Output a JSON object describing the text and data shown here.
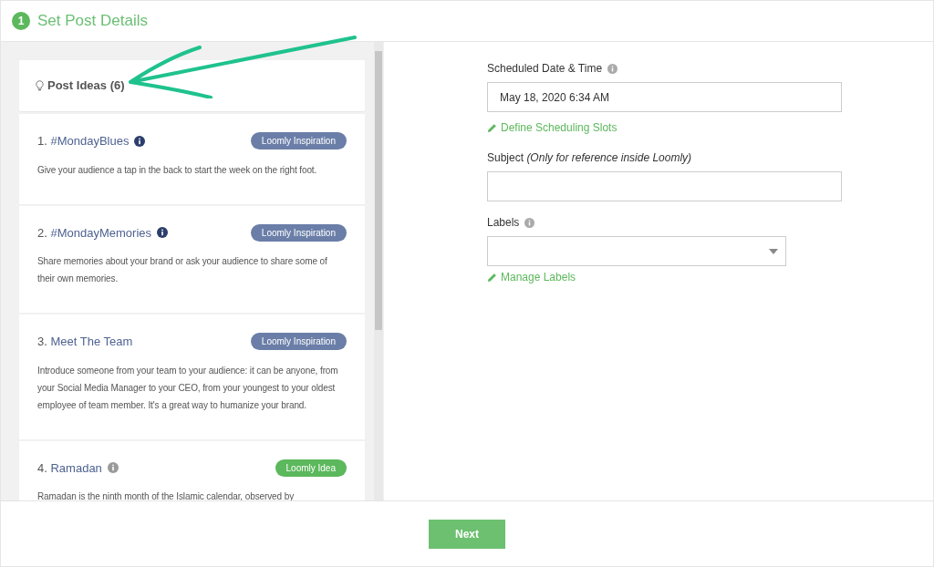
{
  "step": {
    "number": "1",
    "title": "Set Post Details"
  },
  "ideas_panel": {
    "title": "Post Ideas (6)",
    "ideas": [
      {
        "number": "1.",
        "title": "#MondayBlues",
        "info_icon": true,
        "kind": "inspiration",
        "badge": "Loomly Inspiration",
        "description": "Give your audience a tap in the back to start the week on the right foot."
      },
      {
        "number": "2.",
        "title": "#MondayMemories",
        "info_icon": true,
        "kind": "inspiration",
        "badge": "Loomly Inspiration",
        "description": "Share memories about your brand or ask your audience to share some of their own memories."
      },
      {
        "number": "3.",
        "title": "Meet The Team",
        "info_icon": false,
        "kind": "inspiration",
        "badge": "Loomly Inspiration",
        "description": "Introduce someone from your team to your audience: it can be anyone, from your Social Media Manager to your CEO, from your youngest to your oldest employee of team member. It's a great way to humanize your brand."
      },
      {
        "number": "4.",
        "title": "Ramadan",
        "info_icon": true,
        "kind": "idea",
        "badge": "Loomly Idea",
        "description": "Ramadan is the ninth month of the Islamic calendar, observed by"
      }
    ]
  },
  "form": {
    "date_label": "Scheduled Date & Time",
    "date_value": "May 18, 2020 6:34 AM",
    "slots_link": "Define Scheduling Slots",
    "subject_label": "Subject",
    "subject_hint": "(Only for reference inside Loomly)",
    "labels_label": "Labels",
    "labels_link": "Manage Labels"
  },
  "next_button": "Next"
}
